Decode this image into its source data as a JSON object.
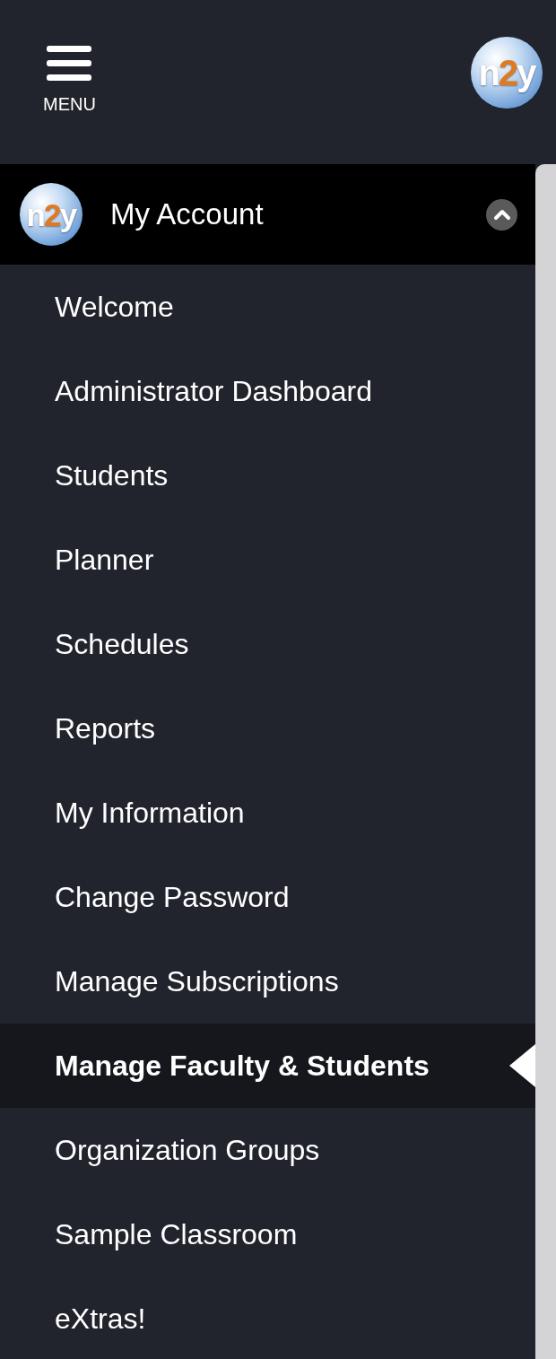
{
  "header": {
    "menu_label": "MENU",
    "logo_text": {
      "left": "n",
      "middle": "2",
      "right": "y"
    }
  },
  "section": {
    "title": "My Account",
    "expanded": true,
    "logo_text": {
      "left": "n",
      "middle": "2",
      "right": "y"
    }
  },
  "items": [
    {
      "label": "Welcome",
      "selected": false
    },
    {
      "label": "Administrator Dashboard",
      "selected": false
    },
    {
      "label": "Students",
      "selected": false
    },
    {
      "label": "Planner",
      "selected": false
    },
    {
      "label": "Schedules",
      "selected": false
    },
    {
      "label": "Reports",
      "selected": false
    },
    {
      "label": "My Information",
      "selected": false
    },
    {
      "label": "Change Password",
      "selected": false
    },
    {
      "label": "Manage Subscriptions",
      "selected": false
    },
    {
      "label": "Manage Faculty & Students",
      "selected": true
    },
    {
      "label": "Organization Groups",
      "selected": false
    },
    {
      "label": "Sample Classroom",
      "selected": false
    },
    {
      "label": "eXtras!",
      "selected": false
    }
  ]
}
